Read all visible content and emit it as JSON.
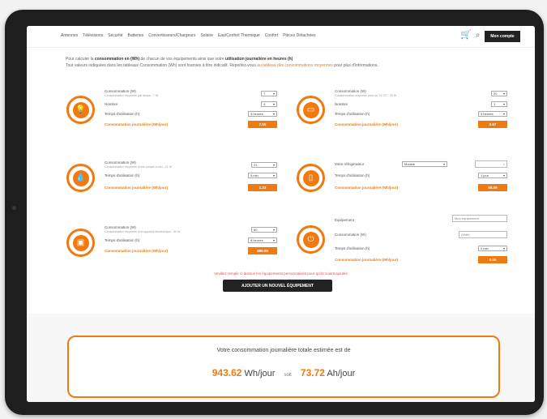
{
  "nav": {
    "menu": [
      "Antennes",
      "Télévisions",
      "Sécurité",
      "Batteries",
      "Convertisseurs/Chargeurs",
      "Solaire",
      "Eau/Confort Thermique",
      "Confort",
      "Pièces Détachées"
    ],
    "account_label": "Mon compte"
  },
  "intro": {
    "l1a": "Pour calculer la",
    "l1b": "consommation en (Wh)",
    "l1c": "de chacun de vos équipements ainsi que votre",
    "l1d": "utilisation journalière en heures (h)",
    "l2a": "Tout valeurs indiquées dans les tableaux Consommation (Wh) sont fournies à titre indicatif. Reportez-vous",
    "l2b": "au tableau des consommations moyennes",
    "l2c": "pour plus d'informations."
  },
  "cards": {
    "c1": {
      "label_consumption": "Consommation (W)",
      "sub": "Consommation moyenne par lampe : 7 W",
      "qty_label": "Nombre",
      "usage_label": "Temps d'utilisation (h)",
      "daily_label": "Consommation journalière (Wh/jour)",
      "power_value": "7",
      "qty_value": "4",
      "usage_value": "3 heures",
      "result": "7.00"
    },
    "c2": {
      "label_consumption": "Consommation (W)",
      "sub": "Consommation moyenne pour un TV 22\" : 20 W",
      "qty_label": "Nombre",
      "usage_label": "Temps d'utilisation (h)",
      "daily_label": "Consommation journalière (Wh/jour)",
      "power_value": "20",
      "qty_value": "1",
      "usage_value": "3 heures",
      "result": "0.67"
    },
    "c3": {
      "label_consumption": "Consommation (W)",
      "sub": "Consommation moyenne d'une pompe à eau : 21 W",
      "usage_label": "Temps d'utilisation (h)",
      "daily_label": "Consommation journalière (Wh/jour)",
      "power_value": "21",
      "usage_value": "5 min",
      "result": "1.23"
    },
    "c4": {
      "label_fridge": "Votre réfrigérateur",
      "fridge_value": "Modèle",
      "usage_label": "Temps d'utilisation (h)",
      "daily_label": "Consommation journalière (Wh/jour)",
      "number_value": "1",
      "usage_value": "1 jour",
      "result": "59.09"
    },
    "c5": {
      "label_consumption": "Consommation (W)",
      "sub": "Consommation moyenne d'un appareil électronique : 60 W",
      "usage_label": "Temps d'utilisation (h)",
      "daily_label": "Consommation journalière (Wh/jour)",
      "power_value": "60",
      "usage_value": "8 heures",
      "result": "480.00"
    },
    "c6": {
      "label_equipment": "Équipement",
      "equipment_placeholder": "Mon équipement",
      "label_consumption": "Consommation (W)",
      "consumption_placeholder": "(Watt)",
      "usage_label": "Temps d'utilisation (h)",
      "daily_label": "Consommation journalière (Wh/jour)",
      "usage_value": "0 min",
      "result": "0.00"
    }
  },
  "note": "Veuillez remplir ci-dessus les équipements personnalisés pour qu'ils soient ajoutés",
  "add_button_label": "AJOUTER UN NOUVEL ÉQUIPEMENT",
  "total": {
    "heading": "Votre consommation journalière totale estimée est de",
    "wh_value": "943.62",
    "wh_unit": "Wh/jour",
    "soit": "soit",
    "ah_value": "73.72",
    "ah_unit": "Ah/jour"
  },
  "colors": {
    "accent": "#f07a12",
    "dark": "#222222"
  }
}
